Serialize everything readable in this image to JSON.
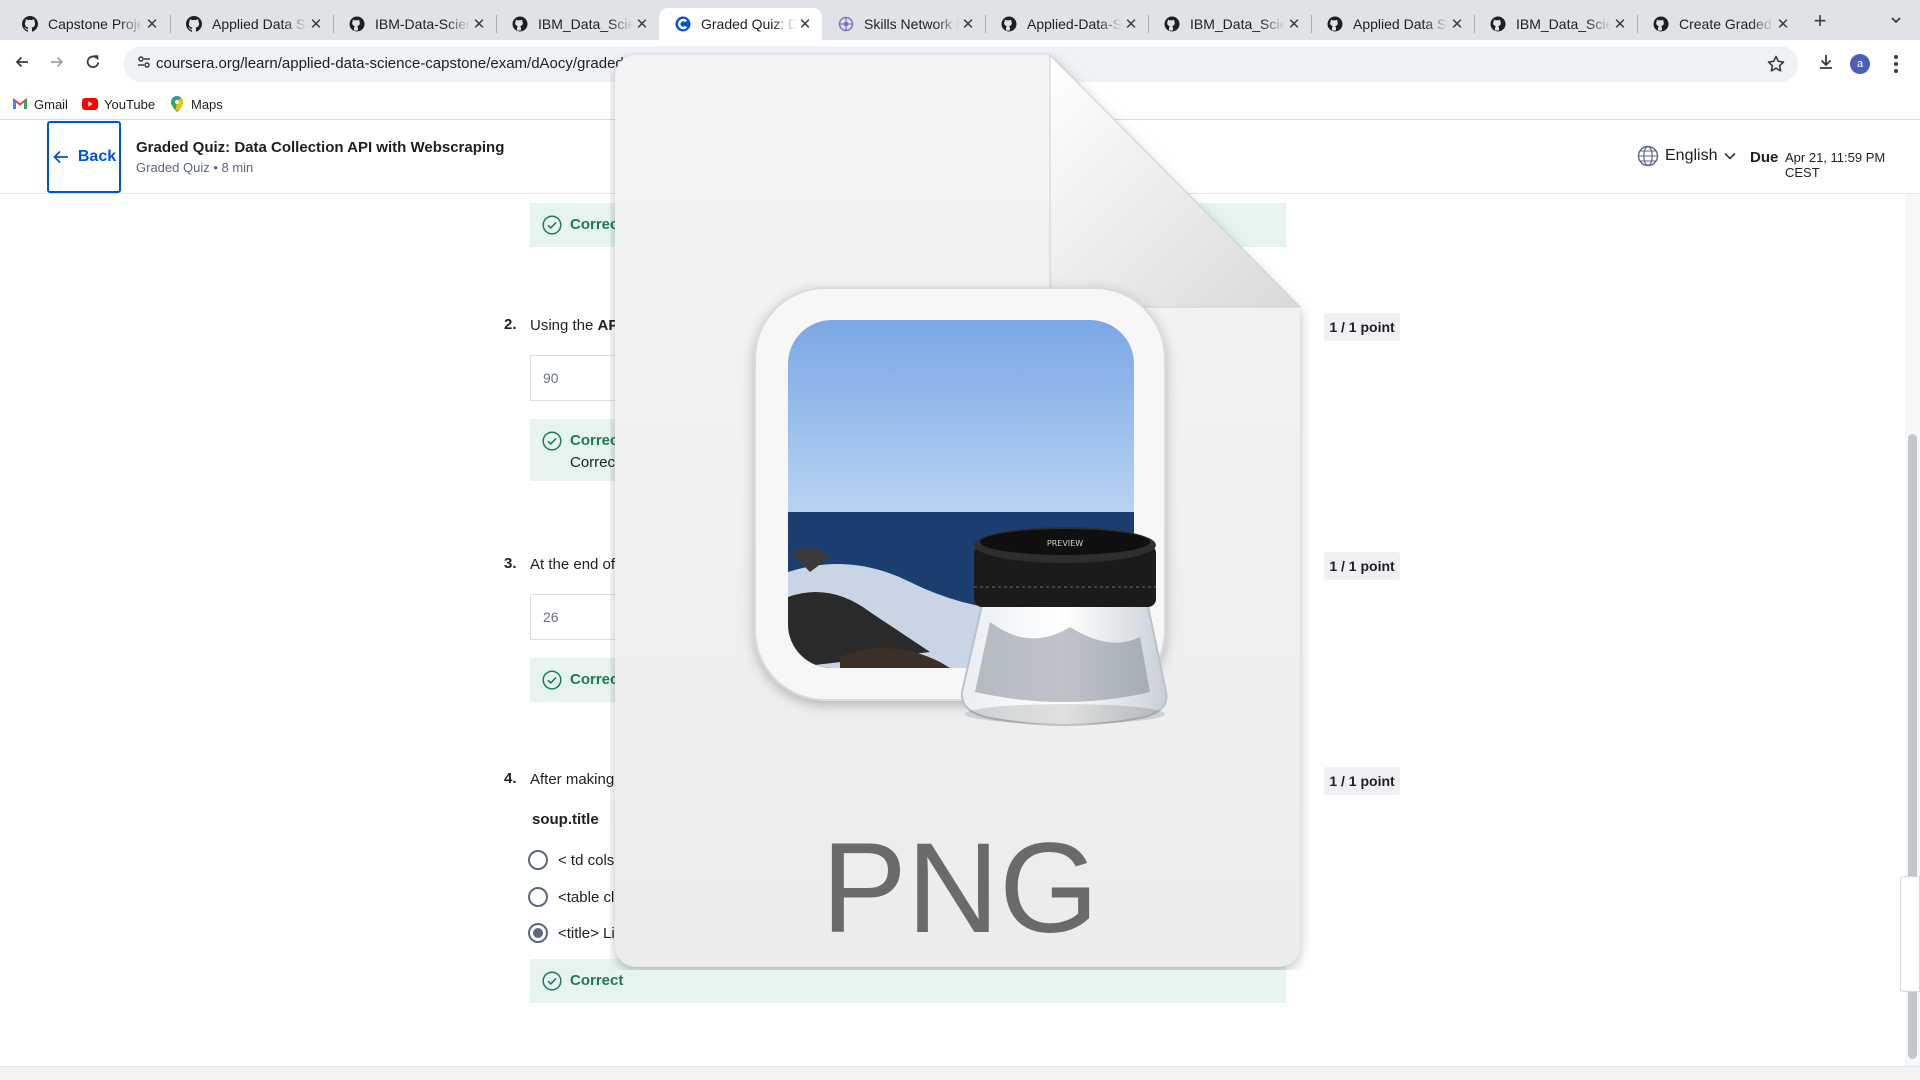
{
  "browser": {
    "tabs": [
      {
        "label": "Capstone Project",
        "icon": "github-icon"
      },
      {
        "label": "Applied Data Science",
        "icon": "github-icon"
      },
      {
        "label": "IBM-Data-Science",
        "icon": "github-icon"
      },
      {
        "label": "IBM_Data_Science",
        "icon": "github-icon"
      },
      {
        "label": "Graded Quiz: Data",
        "icon": "coursera-icon",
        "active": true
      },
      {
        "label": "Skills Network E",
        "icon": "skills-network-icon"
      },
      {
        "label": "Applied-Data-Sc",
        "icon": "github-icon"
      },
      {
        "label": "IBM_Data_Scien",
        "icon": "github-icon"
      },
      {
        "label": "Applied Data Sc",
        "icon": "github-icon"
      },
      {
        "label": "IBM_Data_Scien",
        "icon": "github-icon"
      },
      {
        "label": "Create Graded",
        "icon": "github-icon"
      }
    ],
    "close_glyph": "✕",
    "new_tab_glyph": "+",
    "url": "coursera.org/learn/applied-data-science-capstone/exam/dAocy/graded",
    "avatar_initial": "a",
    "bookmarks": [
      {
        "label": "Gmail",
        "icon": "gmail-icon"
      },
      {
        "label": "YouTube",
        "icon": "youtube-icon"
      },
      {
        "label": "Maps",
        "icon": "maps-icon"
      }
    ]
  },
  "header": {
    "back_label": "Back",
    "title": "Graded Quiz: Data Collection API with Webscraping",
    "subtitle": "Graded Quiz • 8 min",
    "language": "English",
    "due_label": "Due",
    "due_value": "Apr 21, 11:59 PM CEST"
  },
  "quiz": {
    "q1": {
      "feedback": "Correct"
    },
    "q2": {
      "number": "2.",
      "text": "Using the ",
      "bold": "AP",
      "points": "1 / 1 point",
      "answer": "90",
      "feedback": "Correct",
      "feedback_detail": "Correct"
    },
    "q3": {
      "number": "3.",
      "text": "At the end of",
      "points": "1 / 1 point",
      "answer": "26",
      "feedback": "Correct"
    },
    "q4": {
      "number": "4.",
      "text": "After making",
      "points": "1 / 1 point",
      "code": "soup.title",
      "options": [
        "< td cols",
        "<table cl",
        "<title> Li"
      ],
      "selected": 2,
      "feedback": "Correct"
    }
  },
  "overlay": {
    "file_type": "PNG",
    "icon": "preview-app-icon",
    "loupe_text": "PREVIEW"
  },
  "colors": {
    "accent": "#0056d2",
    "success": "#1e7b53",
    "success_bg": "#e7f3ee"
  }
}
